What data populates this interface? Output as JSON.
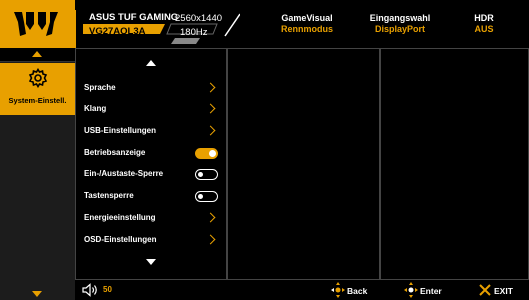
{
  "header": {
    "model_name": "ASUS TUF GAMING",
    "model_code": "VG27AQL3A",
    "resolution": "2560x1440",
    "refresh_rate": "180Hz",
    "columns": [
      {
        "label": "GameVisual",
        "value": "Rennmodus"
      },
      {
        "label": "Eingangswahl",
        "value": "DisplayPort"
      },
      {
        "label": "HDR",
        "value": "AUS"
      }
    ]
  },
  "nav": {
    "active_label": "System-Einstell.",
    "active_icon": "gear-icon"
  },
  "menu": {
    "items": [
      {
        "label": "Sprache",
        "control": "chevron"
      },
      {
        "label": "Klang",
        "control": "chevron"
      },
      {
        "label": "USB-Einstellungen",
        "control": "chevron"
      },
      {
        "label": "Betriebsanzeige",
        "control": "toggle-on"
      },
      {
        "label": "Ein-/Austaste-Sperre",
        "control": "toggle-off"
      },
      {
        "label": "Tastensperre",
        "control": "toggle-off"
      },
      {
        "label": "Energieeinstellung",
        "control": "chevron"
      },
      {
        "label": "OSD-Einstellungen",
        "control": "chevron"
      }
    ]
  },
  "footer": {
    "volume": "50",
    "back_label": "Back",
    "enter_label": "Enter",
    "exit_label": "EXIT"
  },
  "colors": {
    "accent": "#e8a000",
    "background": "#000000",
    "panel_border": "#444444"
  }
}
